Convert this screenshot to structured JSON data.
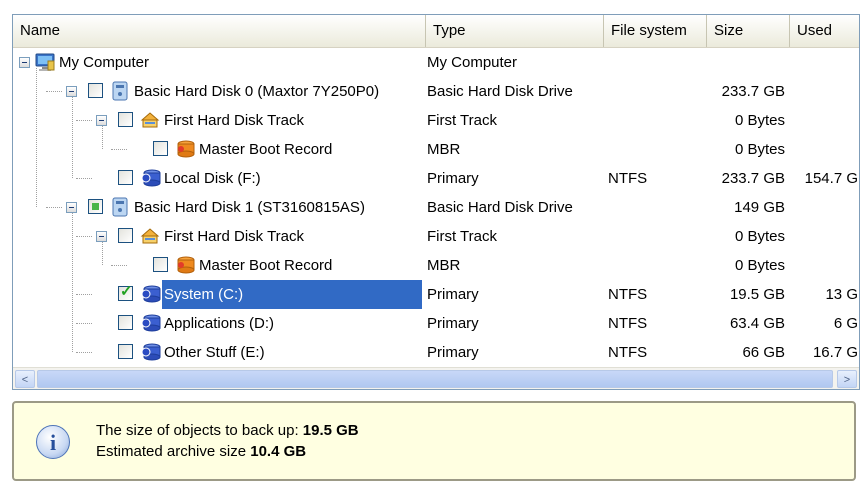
{
  "columns": [
    "Name",
    "Type",
    "File system",
    "Size",
    "Used"
  ],
  "rows": [
    {
      "name": "My Computer",
      "type": "My Computer",
      "fs": "",
      "size": "",
      "used": "",
      "icon": "computer-icon",
      "level": 0,
      "expander": true,
      "checkbox": "none",
      "selected": false
    },
    {
      "name": "Basic Hard Disk 0 (Maxtor 7Y250P0)",
      "type": "Basic Hard Disk Drive",
      "fs": "",
      "size": "233.7 GB",
      "used": "",
      "icon": "hard-disk-icon",
      "level": 1,
      "expander": true,
      "checkbox": "unchecked",
      "selected": false
    },
    {
      "name": "First Hard Disk Track",
      "type": "First Track",
      "fs": "",
      "size": "0 Bytes",
      "used": "",
      "icon": "track-icon",
      "level": 2,
      "expander": true,
      "checkbox": "unchecked",
      "selected": false
    },
    {
      "name": "Master Boot Record",
      "type": "MBR",
      "fs": "",
      "size": "0 Bytes",
      "used": "",
      "icon": "mbr-icon",
      "level": 3,
      "expander": false,
      "checkbox": "unchecked",
      "selected": false
    },
    {
      "name": "Local Disk (F:)",
      "type": "Primary",
      "fs": "NTFS",
      "size": "233.7 GB",
      "used": "154.7 G",
      "icon": "partition-icon",
      "level": 2,
      "expander": false,
      "checkbox": "unchecked",
      "selected": false
    },
    {
      "name": "Basic Hard Disk 1 (ST3160815AS)",
      "type": "Basic Hard Disk Drive",
      "fs": "",
      "size": "149 GB",
      "used": "",
      "icon": "hard-disk-icon",
      "level": 1,
      "expander": true,
      "checkbox": "partial",
      "selected": false
    },
    {
      "name": "First Hard Disk Track",
      "type": "First Track",
      "fs": "",
      "size": "0 Bytes",
      "used": "",
      "icon": "track-icon",
      "level": 2,
      "expander": true,
      "checkbox": "unchecked",
      "selected": false
    },
    {
      "name": "Master Boot Record",
      "type": "MBR",
      "fs": "",
      "size": "0 Bytes",
      "used": "",
      "icon": "mbr-icon",
      "level": 3,
      "expander": false,
      "checkbox": "unchecked",
      "selected": false
    },
    {
      "name": "System (C:)",
      "type": "Primary",
      "fs": "NTFS",
      "size": "19.5 GB",
      "used": "13 G",
      "icon": "partition-icon",
      "level": 2,
      "expander": false,
      "checkbox": "checked",
      "selected": true
    },
    {
      "name": "Applications (D:)",
      "type": "Primary",
      "fs": "NTFS",
      "size": "63.4 GB",
      "used": "6 G",
      "icon": "partition-icon",
      "level": 2,
      "expander": false,
      "checkbox": "unchecked",
      "selected": false
    },
    {
      "name": "Other Stuff (E:)",
      "type": "Primary",
      "fs": "NTFS",
      "size": "66 GB",
      "used": "16.7 G",
      "icon": "partition-icon",
      "level": 2,
      "expander": false,
      "checkbox": "unchecked",
      "selected": false
    }
  ],
  "info": {
    "line1_prefix": "The size of objects to back up: ",
    "line1_value": "19.5 GB",
    "line2_prefix": "Estimated archive size ",
    "line2_value": "10.4 GB"
  },
  "scrollbar": {
    "left_arrow": "<",
    "right_arrow": ">"
  },
  "colors": {
    "selection": "#316ac5",
    "info_background": "#ffffe1",
    "border": "#7f9db9"
  }
}
